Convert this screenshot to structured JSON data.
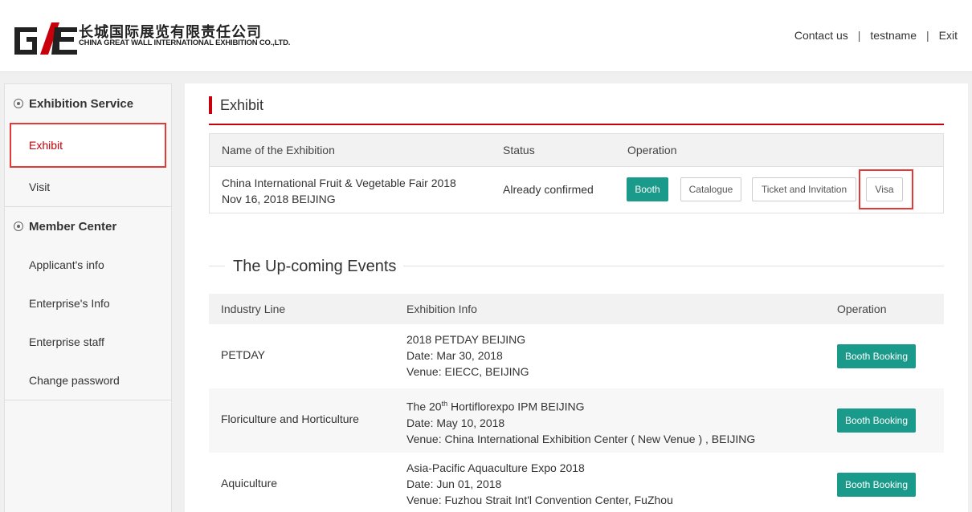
{
  "header": {
    "logo_cn": "长城国际展览有限责任公司",
    "logo_en": "CHINA GREAT WALL INTERNATIONAL EXHIBITION CO.,LTD.",
    "nav": {
      "contact": "Contact us",
      "sep": "|",
      "user": "testname",
      "exit": "Exit"
    }
  },
  "sidebar": {
    "group1": "Exhibition Service",
    "group1_items": [
      "Exhibit",
      "Visit"
    ],
    "group2": "Member Center",
    "group2_items": [
      "Applicant's info",
      "Enterprise's Info",
      "Enterprise staff",
      "Change password"
    ]
  },
  "exhibit": {
    "title": "Exhibit",
    "headers": {
      "name": "Name of the Exhibition",
      "status": "Status",
      "operation": "Operation"
    },
    "row": {
      "name": "China International Fruit & Vegetable Fair 2018",
      "date": "Nov 16, 2018  BEIJING",
      "status": "Already confirmed",
      "buttons": {
        "booth": "Booth",
        "catalogue": "Catalogue",
        "ticket": "Ticket and Invitation",
        "visa": "Visa"
      }
    }
  },
  "upcoming": {
    "title": "The Up-coming Events",
    "headers": {
      "industry": "Industry Line",
      "info": "Exhibition Info",
      "operation": "Operation"
    },
    "rows": [
      {
        "industry": "PETDAY",
        "name": "2018 PETDAY BEIJING",
        "date": "Date: Mar 30, 2018",
        "venue": "Venue: EIECC, BEIJING",
        "button": "Booth Booking"
      },
      {
        "industry": "Floriculture and Horticulture",
        "name_pre": "The 20",
        "name_sup": "th",
        "name_post": " Hortiflorexpo IPM BEIJING",
        "date": "Date: May 10, 2018",
        "venue": "Venue: China International Exhibition Center ( New Venue ) , BEIJING",
        "button": "Booth Booking"
      },
      {
        "industry": "Aquiculture",
        "name": "Asia-Pacific Aquaculture Expo 2018",
        "date": "Date: Jun 01, 2018",
        "venue": "Venue: Fuzhou Strait Int'l Convention Center, FuZhou",
        "button": "Booth Booking"
      }
    ]
  },
  "colors": {
    "brand_red": "#c7000b",
    "accent_teal": "#1a9a8a",
    "highlight_red": "#e53935"
  }
}
